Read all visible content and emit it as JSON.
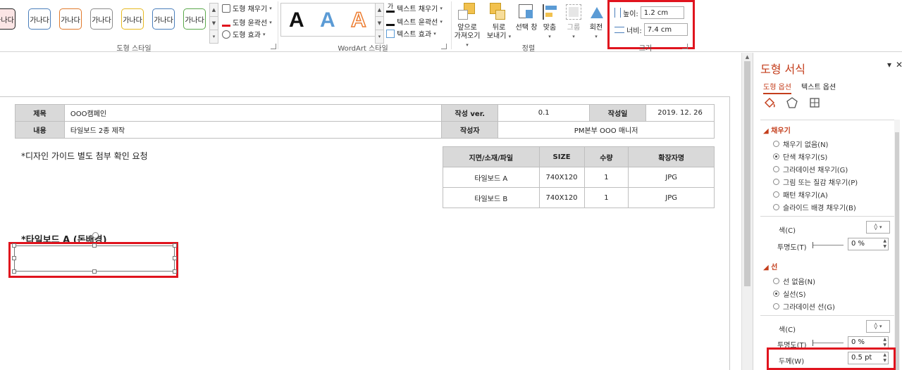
{
  "ribbon": {
    "shape_styles": {
      "swatch_label": "가나다",
      "swatch_colors": [
        "#222222",
        "#4a7ebb",
        "#e07a2c",
        "#8c8c8c",
        "#e6b820",
        "#4a7ebb",
        "#5aa84a"
      ],
      "fill_label": "도형 채우기",
      "outline_label": "도형 윤곽선",
      "effects_label": "도형 효과",
      "group_label": "도형 스타일"
    },
    "wordart": {
      "letter": "A",
      "letter_colors": [
        "#111111",
        "#5b9bd5",
        "#ed7d31"
      ],
      "text_fill_label": "텍스트 채우기",
      "text_outline_label": "텍스트 윤곽선",
      "text_effects_label": "텍스트 효과",
      "group_label": "WordArt 스타일"
    },
    "arrange": {
      "bring_forward_line1": "앞으로",
      "bring_forward_line2": "가져오기",
      "send_backward_line1": "뒤로",
      "send_backward_line2": "보내기",
      "selection_pane": "선택 창",
      "align": "맞춤",
      "group": "그룹",
      "rotate": "회전",
      "group_label": "정렬"
    },
    "size": {
      "height_label": "높이:",
      "height_value": "1.2 cm",
      "width_label": "너비:",
      "width_value": "7.4 cm",
      "group_label": "크기"
    }
  },
  "slide": {
    "info_table": {
      "row1": {
        "title_label": "제목",
        "title_value": "OOO캠페인",
        "ver_label": "작성 ver.",
        "ver_value": "0.1",
        "date_label": "작성일",
        "date_value": "2019. 12. 26"
      },
      "row2": {
        "content_label": "내용",
        "content_value": "타일보드 2종 제작",
        "author_label": "작성자",
        "author_value": "PM본부 OOO 매니저"
      }
    },
    "note": "*디자인 가이드 별도 첨부 확인 요청",
    "spec_table": {
      "headers": [
        "지면/소재/파일",
        "SIZE",
        "수량",
        "확장자명"
      ],
      "rows": [
        [
          "타일보드 A",
          "740X120",
          "1",
          "JPG"
        ],
        [
          "타일보드 B",
          "740X120",
          "1",
          "JPG"
        ]
      ]
    },
    "section_heading": "*타일보드 A (돈배경)"
  },
  "format_pane": {
    "title": "도형 서식",
    "tab_shape": "도형 옵션",
    "tab_text": "텍스트 옵션",
    "fill_section": "채우기",
    "fill_options": [
      "채우기 없음(N)",
      "단색 채우기(S)",
      "그라데이션 채우기(G)",
      "그림 또는 질감 채우기(P)",
      "패턴 채우기(A)",
      "슬라이드 배경 채우기(B)"
    ],
    "fill_selected_index": 1,
    "fill_color_label": "색(C)",
    "fill_transparency_label": "투명도(T)",
    "fill_transparency_value": "0 %",
    "line_section": "선",
    "line_options": [
      "선 없음(N)",
      "실선(S)",
      "그라데이션 선(G)"
    ],
    "line_selected_index": 1,
    "line_color_label": "색(C)",
    "line_transparency_label": "투명도(T)",
    "line_transparency_value": "0 %",
    "line_width_label": "두께(W)",
    "line_width_value": "0.5 pt"
  }
}
